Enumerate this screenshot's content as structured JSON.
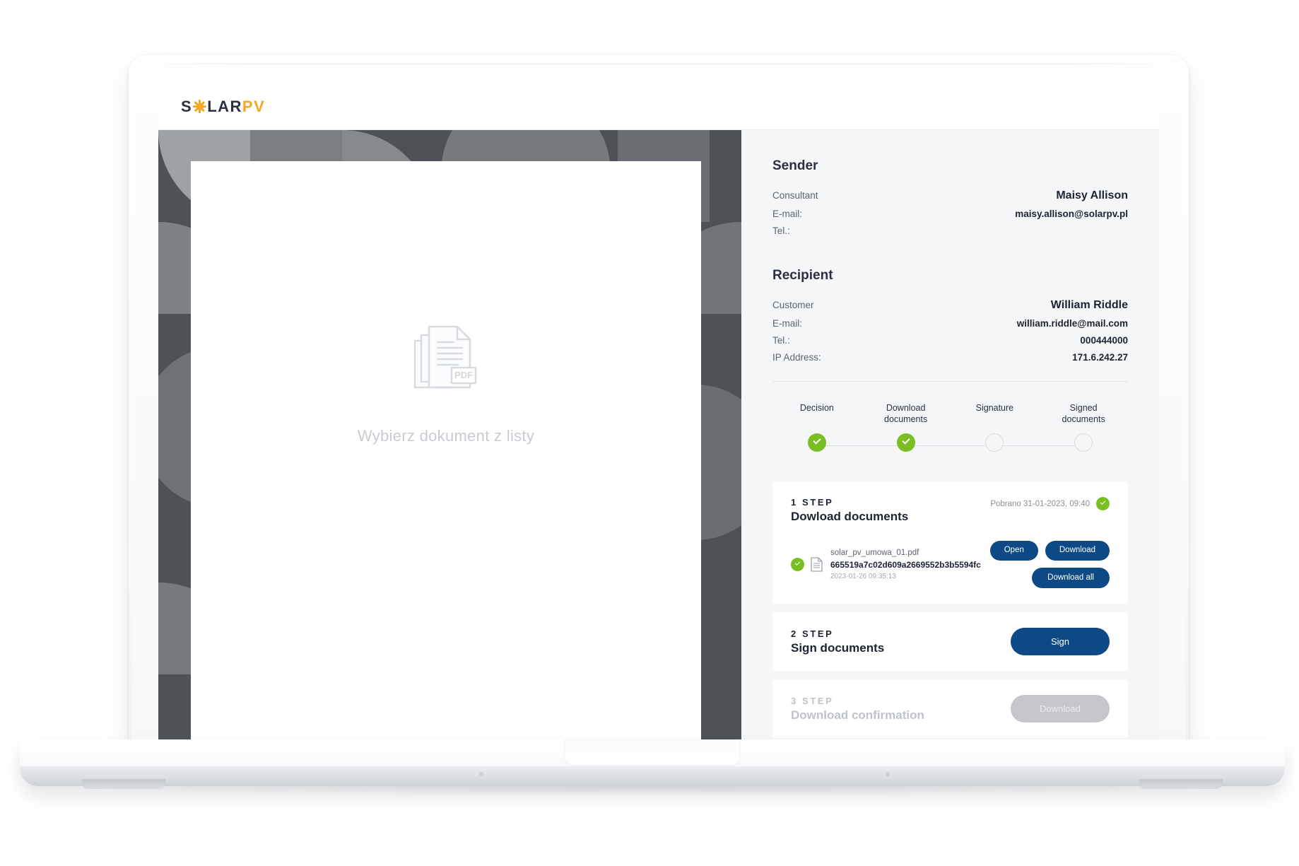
{
  "app": {
    "logo": {
      "part1": "S",
      "sun": "sun-icon",
      "part2": "LAR",
      "part3": "PV"
    }
  },
  "viewer": {
    "placeholder_text": "Wybierz dokument z listy",
    "pdf_badge": "PDF",
    "icon": "pdf-document-icon"
  },
  "sender": {
    "title": "Sender",
    "rows": [
      {
        "label": "Consultant",
        "value": "Maisy Allison",
        "emphasis": "name"
      },
      {
        "label": "E-mail:",
        "value": "maisy.allison@solarpv.pl",
        "emphasis": "normal"
      },
      {
        "label": "Tel.:",
        "value": "",
        "emphasis": "normal"
      }
    ]
  },
  "recipient": {
    "title": "Recipient",
    "rows": [
      {
        "label": "Customer",
        "value": "William Riddle",
        "emphasis": "name"
      },
      {
        "label": "E-mail:",
        "value": "william.riddle@mail.com",
        "emphasis": "normal"
      },
      {
        "label": "Tel.:",
        "value": "000444000",
        "emphasis": "normal"
      },
      {
        "label": "IP Address:",
        "value": "171.6.242.27",
        "emphasis": "normal"
      }
    ]
  },
  "stepper": {
    "steps": [
      {
        "label": "Decision",
        "state": "done"
      },
      {
        "label": "Download\ndocuments",
        "state": "done"
      },
      {
        "label": "Signature",
        "state": "todo"
      },
      {
        "label": "Signed\ndocuments",
        "state": "todo"
      }
    ]
  },
  "steps": {
    "step1": {
      "number": "1  STEP",
      "title": "Dowload documents",
      "stamp": "Pobrano 31-01-2023, 09:40",
      "status": "done",
      "file": {
        "name": "solar_pv_umowa_01.pdf",
        "hash": "665519a7c02d609a2669552b3b5594fc",
        "date": "2023-01-26 09:35:13"
      },
      "open_label": "Open",
      "download_label": "Download",
      "download_all_label": "Download all"
    },
    "step2": {
      "number": "2  STEP",
      "title": "Sign documents",
      "sign_label": "Sign"
    },
    "step3": {
      "number": "3  STEP",
      "title": "Download confirmation",
      "download_label": "Download",
      "disabled": true
    }
  },
  "colors": {
    "brand_amber": "#f5a623",
    "brand_dark": "#2b3040",
    "accent_blue": "#0d4a85",
    "success_green": "#79bf23",
    "panel_bg": "#f5f6f8",
    "viewer_bg": "#4e5256",
    "disabled_grey": "#c4c6cb"
  }
}
